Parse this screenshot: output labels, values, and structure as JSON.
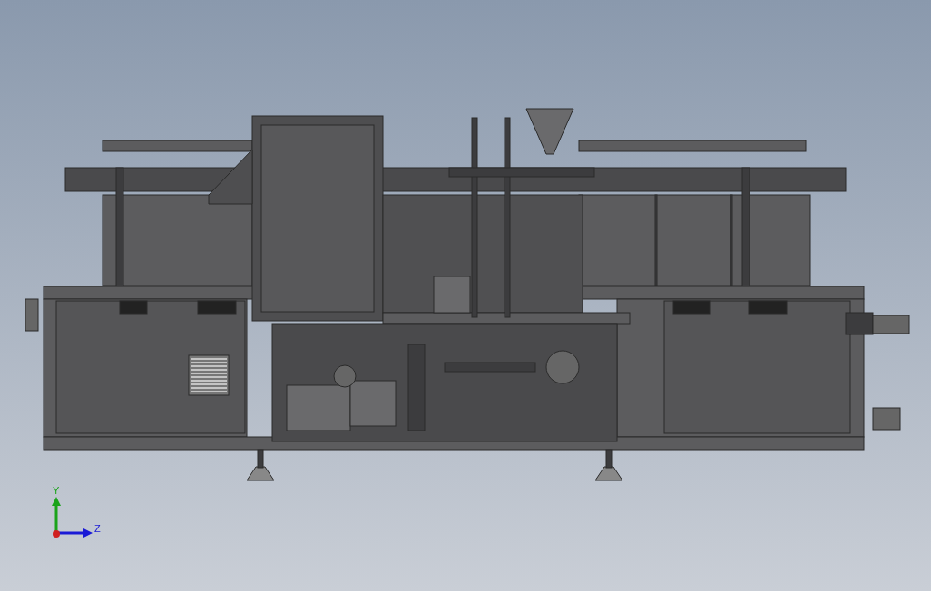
{
  "viewport": {
    "triad": {
      "axes": [
        {
          "label": "Y",
          "kind": "vertical",
          "color": "#1aa31a"
        },
        {
          "label": "Z",
          "kind": "horizontal",
          "color": "#1a1ad6"
        }
      ]
    }
  }
}
